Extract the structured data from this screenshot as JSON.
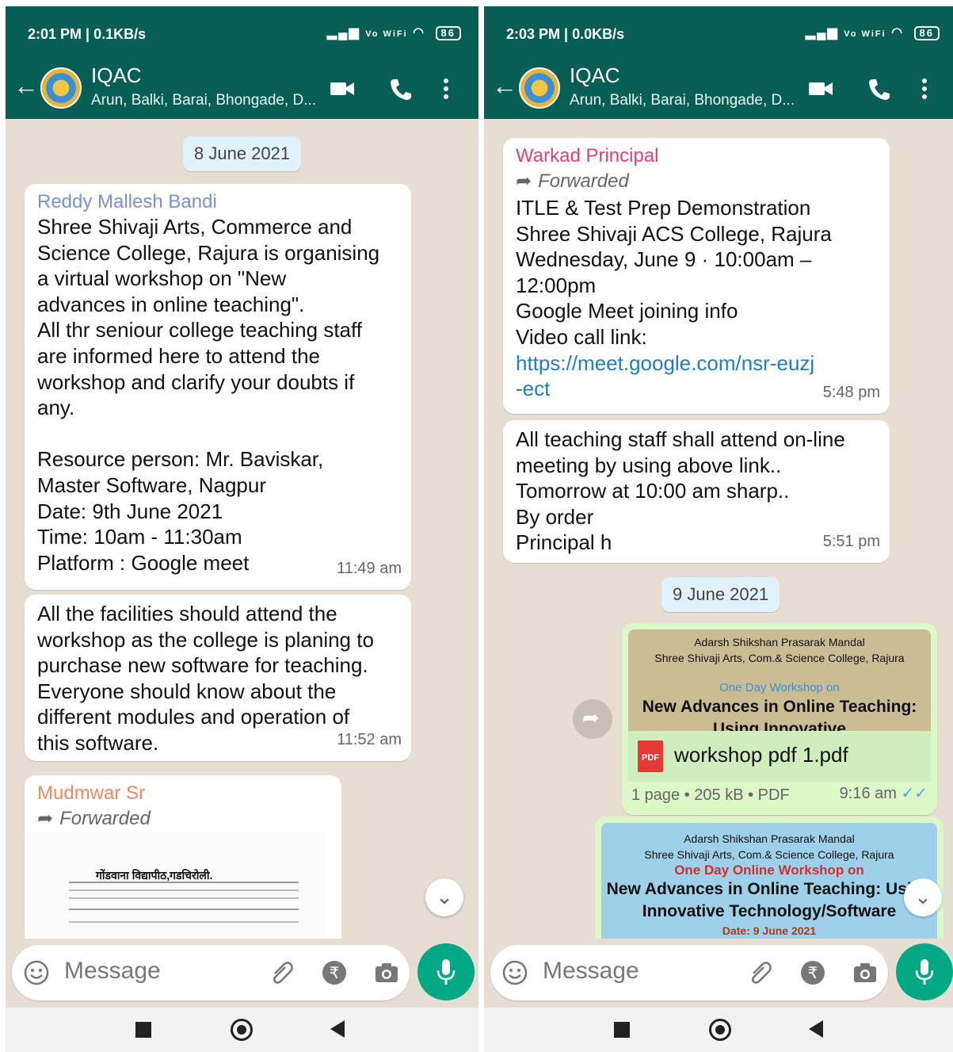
{
  "left": {
    "status": {
      "time": "2:01 PM | 0.1KB/s",
      "icons": "Vo WiFi",
      "battery": "86"
    },
    "header": {
      "title": "IQAC",
      "subtitle": "Arun, Balki, Barai, Bhongade, D..."
    },
    "date_chip": "8 June 2021",
    "messages": [
      {
        "sender": "Reddy Mallesh Bandi",
        "sender_color": "#7b8fd6",
        "text": "Shree Shivaji Arts, Commerce and\nScience College, Rajura is organising\na virtual workshop on \"New\nadvances in online teaching\".\nAll thr seniour college teaching staff\nare informed here to attend the\nworkshop and clarify your doubts if\nany.\n\nResource person: Mr. Baviskar,\nMaster Software, Nagpur\nDate: 9th June 2021\nTime: 10am - 11:30am\nPlatform : Google meet",
        "time": "11:49 am"
      },
      {
        "text": "All the facilities should attend the\nworkshop as the college is planing to\npurchase new software for teaching.\nEveryone should know about the\ndifferent modules and operation of\nthis software.",
        "time": "11:52 am"
      },
      {
        "sender": "Mudmwar Sr",
        "sender_color": "#f0875a",
        "forwarded": "Forwarded",
        "image_caption": "गोंडवाना विद्यापीठ,गडचिरोली."
      }
    ],
    "input": {
      "placeholder": "Message"
    }
  },
  "right": {
    "status": {
      "time": "2:03 PM | 0.0KB/s",
      "icons": "Vo WiFi",
      "battery": "86"
    },
    "header": {
      "title": "IQAC",
      "subtitle": "Arun, Balki, Barai, Bhongade, D..."
    },
    "messages": [
      {
        "sender": "Warkad Principal",
        "sender_color": "#e0407a",
        "forwarded": "Forwarded",
        "text": "ITLE & Test Prep Demonstration\nShree Shivaji ACS College, Rajura\nWednesday, June 9 · 10:00am –\n12:00pm\nGoogle Meet joining info\nVideo call link:",
        "link": "https://meet.google.com/nsr-euzj\n-ect",
        "time": "5:48 pm"
      },
      {
        "text": "All teaching staff shall attend on-line\nmeeting by using above link..\nTomorrow at 10:00 am sharp..\nBy order\nPrincipal h",
        "time": "5:51 pm"
      }
    ],
    "date_chip": "9 June 2021",
    "doc1": {
      "thumb_line1": "Adarsh Shikshan Prasarak Mandal",
      "thumb_line2": "Shree Shivaji Arts, Com.& Science College, Rajura",
      "thumb_line3": "One Day Workshop on",
      "thumb_line4": "New Advances in Online Teaching:",
      "thumb_line5": "Using Innovative Technology/Software",
      "filename": "workshop pdf 1.pdf",
      "pdf_label": "PDF",
      "meta": "1 page • 205 kB • PDF",
      "time": "9:16 am"
    },
    "doc2": {
      "thumb_line1": "Adarsh Shikshan Prasarak Mandal",
      "thumb_line2": "Shree Shivaji Arts, Com.& Science College, Rajura",
      "thumb_line3": "One Day Online Workshop on",
      "thumb_line4": "New Advances in Online Teaching: Using",
      "thumb_line5": "Innovative Technology/Software",
      "thumb_line6": "Date: 9 June 2021"
    },
    "input": {
      "placeholder": "Message"
    }
  },
  "colors": {
    "header": "#075e54",
    "accent": "#00a884",
    "chat_bg": "#e6ddd3",
    "outgoing": "#dcf8c6"
  }
}
